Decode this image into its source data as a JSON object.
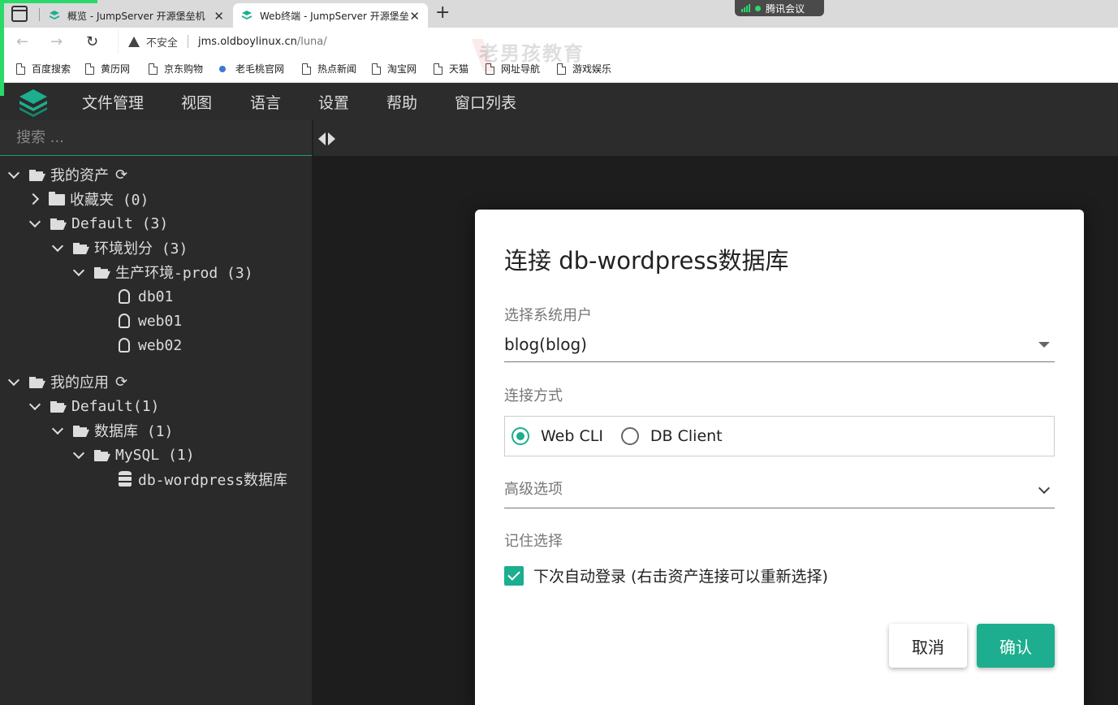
{
  "browser": {
    "tabs": [
      {
        "title": "概览 - JumpServer 开源堡垒机",
        "close": "✕"
      },
      {
        "title": "Web终端 - JumpServer 开源堡垒",
        "close": "✕"
      }
    ],
    "new_tab": "+",
    "meeting_label": "腾讯会议",
    "address": {
      "security_warning": "不安全",
      "host": "jms.oldboylinux.cn",
      "path": "/luna/"
    },
    "nav": {
      "back": "←",
      "forward": "→",
      "reload": "↻"
    },
    "bookmarks": [
      "百度搜索",
      "黄历网",
      "京东购物",
      "老毛桃官网",
      "热点新闻",
      "淘宝网",
      "天猫",
      "网址导航",
      "游戏娱乐"
    ],
    "watermark": "老男孩教育"
  },
  "app": {
    "menu": [
      "文件管理",
      "视图",
      "语言",
      "设置",
      "帮助",
      "窗口列表"
    ],
    "search_placeholder": "搜索 ...",
    "tree": {
      "my_assets": "我的资产",
      "favorites": "收藏夹 (0)",
      "default": "Default (3)",
      "env": "环境划分 (3)",
      "prod": "生产环境-prod (3)",
      "hosts": [
        "db01",
        "web01",
        "web02"
      ],
      "my_apps": "我的应用",
      "app_default": "Default(1)",
      "databases": "数据库 (1)",
      "mysql": "MySQL (1)",
      "db_app": "db-wordpress数据库"
    },
    "refresh_glyph": "⟳"
  },
  "dialog": {
    "title": "连接 db-wordpress数据库",
    "system_user_label": "选择系统用户",
    "system_user_value": "blog(blog)",
    "connect_method_label": "连接方式",
    "methods": [
      {
        "label": "Web CLI",
        "selected": true
      },
      {
        "label": "DB Client",
        "selected": false
      }
    ],
    "advanced_label": "高级选项",
    "remember_label": "记住选择",
    "auto_login_label": "下次自动登录 (右击资产连接可以重新选择)",
    "auto_login_checked": true,
    "cancel": "取消",
    "confirm": "确认"
  },
  "colors": {
    "accent": "#1cae8e",
    "menubar": "#2c2c2c",
    "sidebar": "#2a2a2a"
  }
}
